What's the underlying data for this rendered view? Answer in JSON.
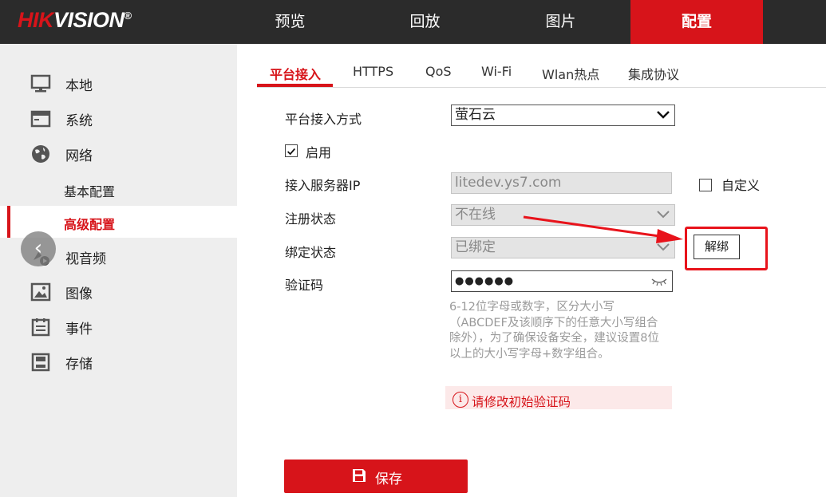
{
  "brand": {
    "logo_red": "HIK",
    "logo_white": "VISION",
    "logo_mark": "®"
  },
  "topnav": [
    "预览",
    "回放",
    "图片",
    "配置"
  ],
  "sidebar": {
    "items": [
      "本地",
      "系统",
      "网络"
    ],
    "sub_items": [
      "基本配置",
      "高级配置"
    ],
    "items_after": [
      "视音频",
      "图像",
      "事件",
      "存储"
    ]
  },
  "tabs": [
    "平台接入",
    "HTTPS",
    "QoS",
    "Wi-Fi",
    "Wlan热点",
    "集成协议"
  ],
  "form": {
    "access_mode_label": "平台接入方式",
    "access_mode_value": "萤石云",
    "enable_label": "启用",
    "server_ip_label": "接入服务器IP",
    "server_ip_value": "litedev.ys7.com",
    "custom_label": "自定义",
    "register_label": "注册状态",
    "register_value": "不在线",
    "bind_label": "绑定状态",
    "bind_value": "已绑定",
    "unbind_button": "解绑",
    "code_label": "验证码",
    "code_value": "●●●●●●",
    "hint": "6-12位字母或数字，区分大小写（ABCDEF及该顺序下的任意大小写组合除外），为了确保设备安全，建议设置8位以上的大小写字母+数字组合。",
    "warning": "请修改初始验证码",
    "save_button": "保存"
  },
  "colors": {
    "accent": "#d7141a",
    "topbar": "#2b2b2b",
    "sidebar": "#eeeeee",
    "annotation": "#e8131b"
  },
  "icons": [
    "monitor-icon",
    "system-icon",
    "globe-icon",
    "video-audio-icon",
    "image-icon",
    "event-icon",
    "storage-icon",
    "save-icon",
    "eye-closed-icon",
    "chevron-down-icon",
    "info-icon"
  ]
}
